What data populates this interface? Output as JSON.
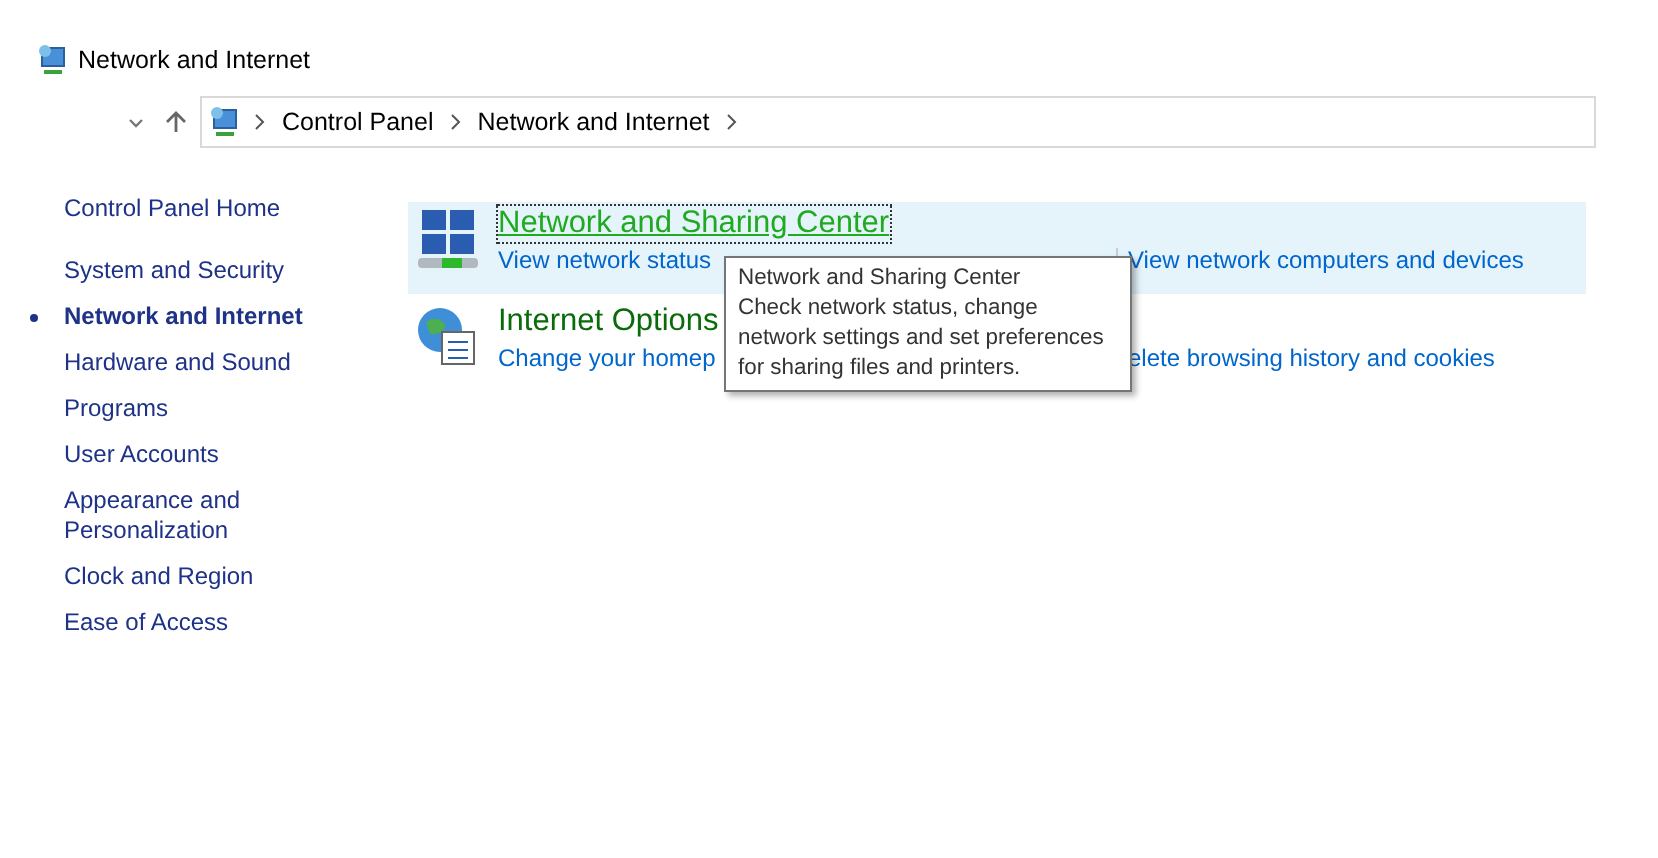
{
  "window": {
    "title": "Network and Internet"
  },
  "address_bar": {
    "crumbs": [
      "Control Panel",
      "Network and Internet"
    ]
  },
  "sidebar": {
    "home": "Control Panel Home",
    "items": [
      {
        "label": "System and Security",
        "selected": false
      },
      {
        "label": "Network and Internet",
        "selected": true
      },
      {
        "label": "Hardware and Sound",
        "selected": false
      },
      {
        "label": "Programs",
        "selected": false
      },
      {
        "label": "User Accounts",
        "selected": false
      },
      {
        "label": "Appearance and Personalization",
        "selected": false
      },
      {
        "label": "Clock and Region",
        "selected": false
      },
      {
        "label": "Ease of Access",
        "selected": false
      }
    ]
  },
  "categories": [
    {
      "kind": "network",
      "title": "Network and Sharing Center",
      "hovered": true,
      "links": [
        "View network status",
        "View network computers and devices"
      ]
    },
    {
      "kind": "internet",
      "title": "Internet Options",
      "hovered": false,
      "links": [
        "Change your homep",
        "elete browsing history and cookies"
      ]
    }
  ],
  "tooltip": {
    "title": "Network and Sharing Center",
    "text": "Check network status, change network settings and set preferences for sharing files and printers."
  }
}
